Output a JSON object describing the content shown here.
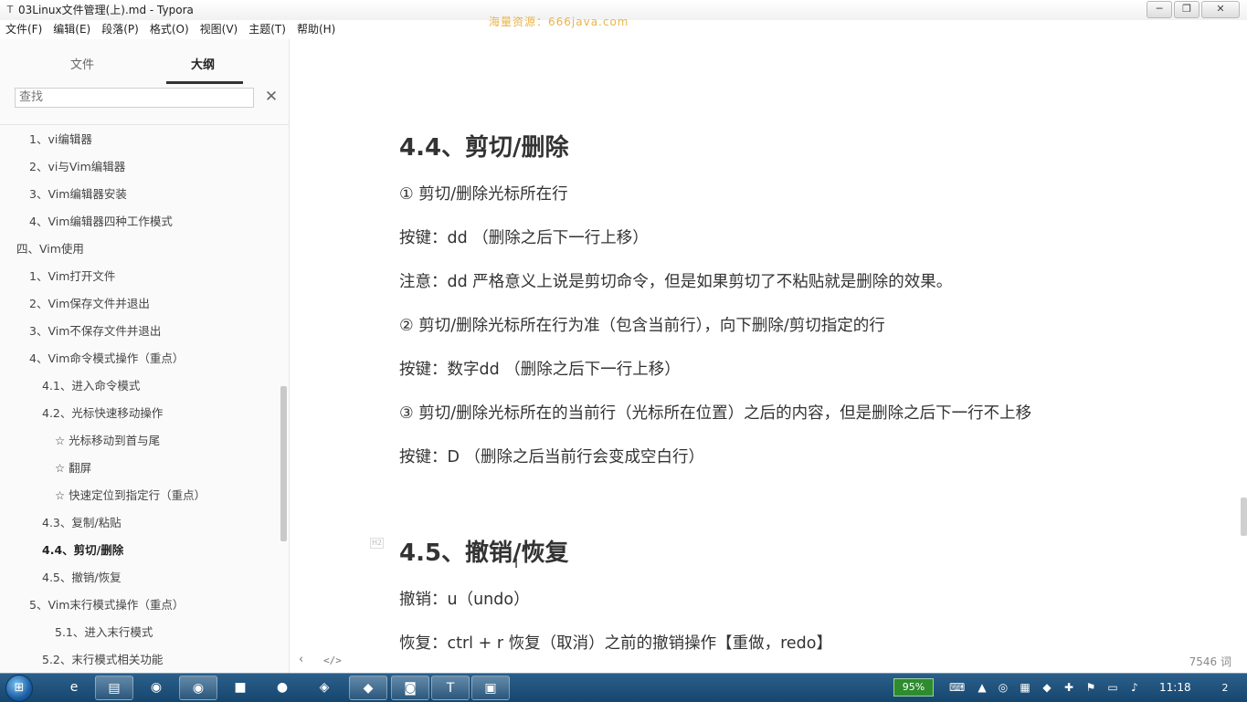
{
  "window": {
    "title": "03Linux文件管理(上).md - Typora",
    "watermark": "海量资源：666java.com",
    "minimize_icon": "minimize-icon",
    "maximize_icon": "restore-icon",
    "close_icon": "close-icon"
  },
  "menu": [
    {
      "label": "文件(F)"
    },
    {
      "label": "编辑(E)"
    },
    {
      "label": "段落(P)"
    },
    {
      "label": "格式(O)"
    },
    {
      "label": "视图(V)"
    },
    {
      "label": "主题(T)"
    },
    {
      "label": "帮助(H)"
    }
  ],
  "sidebar": {
    "tab_files": "文件",
    "tab_outline": "大纲",
    "search_placeholder": "查找",
    "outline": [
      {
        "label": "1、vi编辑器",
        "level": 1
      },
      {
        "label": "2、vi与Vim编辑器",
        "level": 1
      },
      {
        "label": "3、Vim编辑器安装",
        "level": 1
      },
      {
        "label": "4、Vim编辑器四种工作模式",
        "level": 1
      },
      {
        "label": "四、Vim使用",
        "level": 0
      },
      {
        "label": "1、Vim打开文件",
        "level": 1
      },
      {
        "label": "2、Vim保存文件并退出",
        "level": 1
      },
      {
        "label": "3、Vim不保存文件并退出",
        "level": 1
      },
      {
        "label": "4、Vim命令模式操作（重点）",
        "level": 1
      },
      {
        "label": "4.1、进入命令模式",
        "level": 2
      },
      {
        "label": "4.2、光标快速移动操作",
        "level": 2
      },
      {
        "label": "☆ 光标移动到首与尾",
        "level": 3
      },
      {
        "label": "☆ 翻屏",
        "level": 3
      },
      {
        "label": "☆ 快速定位到指定行（重点）",
        "level": 3
      },
      {
        "label": "4.3、复制/粘贴",
        "level": 2
      },
      {
        "label": "4.4、剪切/删除",
        "level": 2,
        "active": true
      },
      {
        "label": "4.5、撤销/恢复",
        "level": 2
      },
      {
        "label": "5、Vim末行模式操作（重点）",
        "level": 1
      },
      {
        "label": "5.1、进入末行模式",
        "level": 3
      },
      {
        "label": "5.2、末行模式相关功能",
        "level": 2
      }
    ]
  },
  "document": {
    "h_cut": "4.4、剪切/删除",
    "p1": "① 剪切/删除光标所在行",
    "p2": "按键：dd （删除之后下一行上移）",
    "p3": "注意：dd 严格意义上说是剪切命令，但是如果剪切了不粘贴就是删除的效果。",
    "p4": "② 剪切/删除光标所在行为准（包含当前行），向下删除/剪切指定的行",
    "p5": "按键：数字dd （删除之后下一行上移）",
    "p6": "③ 剪切/删除光标所在的当前行（光标所在位置）之后的内容，但是删除之后下一行不上移",
    "p7": "按键：D （删除之后当前行会变成空白行）",
    "heading_tag": "H2",
    "h_undo": "4.5、撤销/恢复",
    "p8": "撤销：u（undo）",
    "p9": "恢复：ctrl + r 恢复（取消）之前的撤销操作【重做，redo】"
  },
  "footer": {
    "back_label": "‹",
    "source_label": "</>",
    "word_count": "7546 词"
  },
  "taskbar": {
    "battery": "95%",
    "clock": "11:18",
    "badge": "2"
  }
}
